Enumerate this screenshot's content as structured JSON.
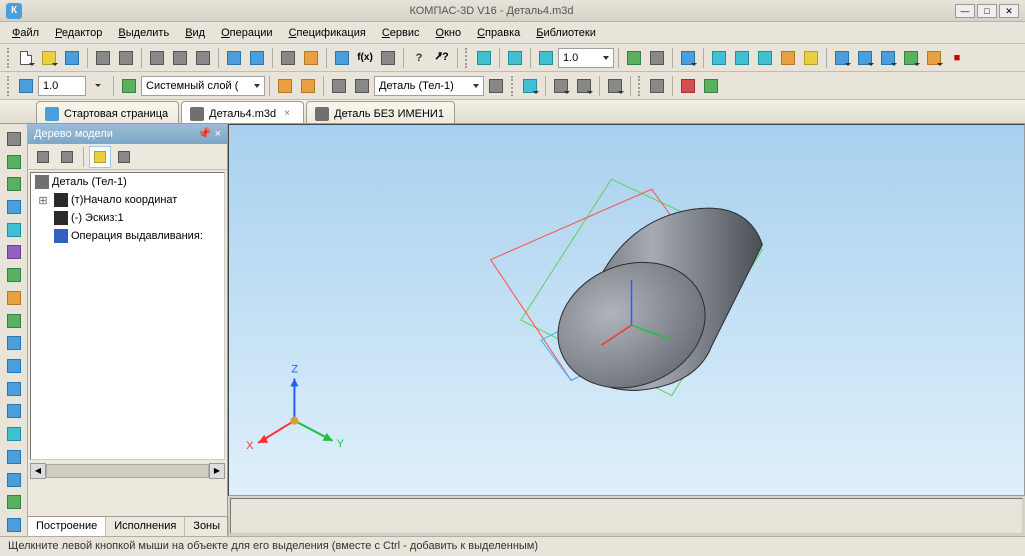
{
  "title": "КОМПАС-3D V16  -  Деталь4.m3d",
  "menu": {
    "file": "Файл",
    "editor": "Редактор",
    "select": "Выделить",
    "view": "Вид",
    "operations": "Операции",
    "spec": "Спецификация",
    "service": "Сервис",
    "window": "Окно",
    "help": "Справка",
    "libs": "Библиотеки"
  },
  "toolbar2": {
    "scale": "1.0",
    "layer": "Системный слой ( ",
    "body": "Деталь (Тел-1)"
  },
  "zoom": "1.0",
  "tabs": {
    "start": "Стартовая страница",
    "doc1": "Деталь4.m3d",
    "doc2": "Деталь БЕЗ ИМЕНИ1"
  },
  "panel": {
    "title": "Дерево модели",
    "root": "Деталь (Тел-1)",
    "origin": "(т)Начало координат",
    "sketch": "(-) Эскиз:1",
    "extrude": "Операция выдавливания:",
    "tab_build": "Построение",
    "tab_exec": "Исполнения",
    "tab_zones": "Зоны"
  },
  "orient": {
    "x": "X",
    "y": "Y",
    "z": "Z"
  },
  "status": "Щелкните левой кнопкой мыши на объекте для его выделения (вместе с Ctrl - добавить к выделенным)"
}
